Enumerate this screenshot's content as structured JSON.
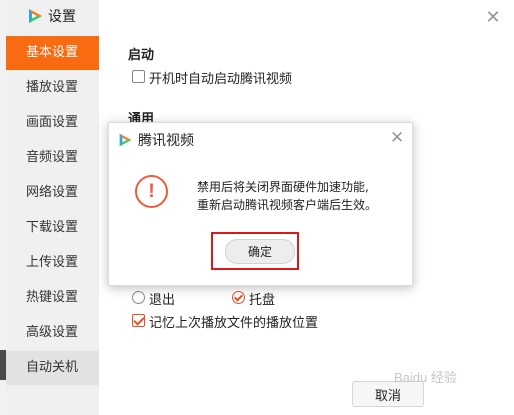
{
  "window": {
    "title": "设置",
    "close_icon": "close-icon"
  },
  "sidebar": {
    "items": [
      {
        "label": "基本设置",
        "active": true
      },
      {
        "label": "播放设置"
      },
      {
        "label": "画面设置"
      },
      {
        "label": "音频设置"
      },
      {
        "label": "网络设置"
      },
      {
        "label": "下载设置"
      },
      {
        "label": "上传设置"
      },
      {
        "label": "热键设置"
      },
      {
        "label": "高级设置"
      },
      {
        "label": "自动关机"
      }
    ]
  },
  "settings": {
    "startup_title": "启动",
    "startup_option": "开机时自动启动腾讯视频",
    "general_title": "通用",
    "exit_option": "退出",
    "tray_option": "托盘",
    "remember_option": "记忆上次播放文件的播放位置",
    "cancel_label": "取消"
  },
  "dialog": {
    "title": "腾讯视频",
    "line1": "禁用后将关闭界面硬件加速功能,",
    "line2": "重新启动腾讯视频客户端后生效。",
    "ok_label": "确定",
    "warning_icon": "!"
  },
  "watermark": "Baidu 经验",
  "colors": {
    "accent": "#f96b10",
    "warning": "#ef5a3c",
    "highlight": "#d71a1a"
  }
}
